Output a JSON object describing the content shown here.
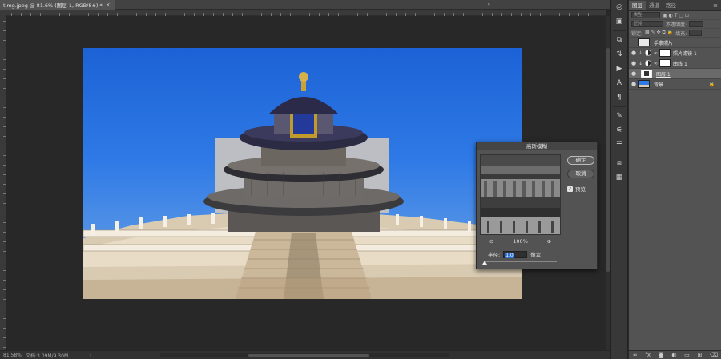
{
  "document_tab": {
    "title": "timg.jpeg @ 81.6% (图层 1, RGB/8#) *",
    "close": "×"
  },
  "collapse": "»",
  "status_bar": {
    "zoom": "81.58%",
    "doc_info": "文档:3.09M/9.30M",
    "arrow": "›"
  },
  "layers_panel": {
    "tabs": [
      "图层",
      "通道",
      "路径"
    ],
    "menu": "≡",
    "filter_kind": "类型",
    "blend_mode": "正常",
    "opacity_label": "不透明度:",
    "lock_label": "锁定:",
    "fill_label": "填充:",
    "layers": [
      {
        "name": "手拿照片",
        "visible": false,
        "type": "smart"
      },
      {
        "name": "照片滤镜 1",
        "visible": true,
        "type": "adjustment"
      },
      {
        "name": "曲线 1",
        "visible": true,
        "type": "adjustment"
      },
      {
        "name": "图层 1",
        "visible": true,
        "type": "pixel",
        "selected": true
      },
      {
        "name": "背景",
        "visible": true,
        "type": "background",
        "locked": true
      }
    ]
  },
  "blur_dialog": {
    "title": "高斯模糊",
    "ok_label": "确定",
    "cancel_label": "取消",
    "preview_label": "预览",
    "preview_checked": true,
    "zoom_level": "100%",
    "radius_label": "半径:",
    "radius_value": "1.0",
    "radius_unit": "像素",
    "slider_fraction": 0.0
  },
  "colors": {
    "sky": "#2f7ae6",
    "panel": "#535353",
    "accent": "#2e6fd3"
  }
}
